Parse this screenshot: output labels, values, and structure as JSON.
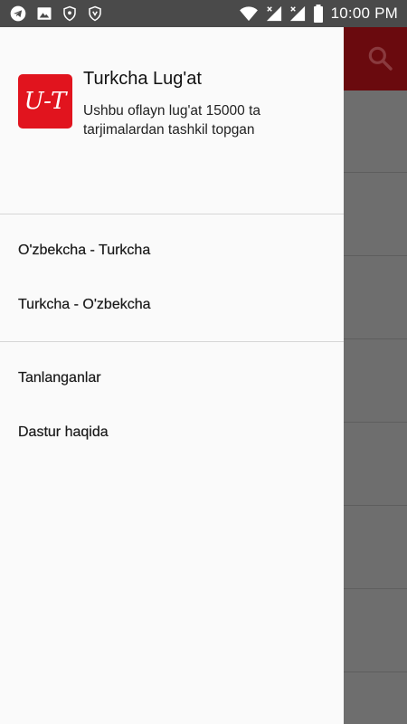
{
  "status_bar": {
    "time": "10:00 PM",
    "icons_left": [
      "telegram-icon",
      "image-icon",
      "shield-icon",
      "shield-icon"
    ],
    "icons_right": [
      "wifi-icon",
      "signal-icon",
      "signal-icon",
      "battery-icon"
    ]
  },
  "drawer": {
    "logo_text": "U-T",
    "app_title": "Turkcha Lug'at",
    "app_subtitle": "Ushbu oflayn lug'at 15000 ta tarjimalardan tashkil topgan",
    "menu_group_1": [
      {
        "label": "O'zbekcha - Turkcha"
      },
      {
        "label": "Turkcha - O'zbekcha"
      }
    ],
    "menu_group_2": [
      {
        "label": "Tanlanganlar"
      },
      {
        "label": "Dastur haqida"
      }
    ]
  },
  "colors": {
    "accent": "#e1141e",
    "toolbar_dimmed": "#6a0a0e",
    "scrim": "#6e6e6e"
  }
}
